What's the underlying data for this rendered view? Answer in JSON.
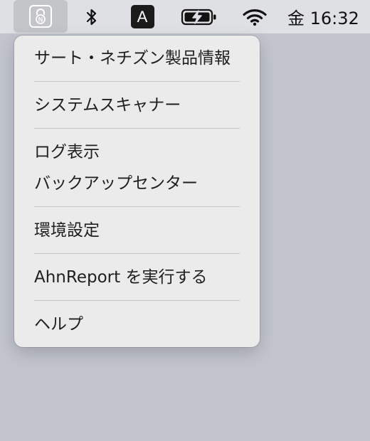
{
  "menubar": {
    "app_icon": "ahnlab-shield-lock-icon",
    "bluetooth_icon": "bluetooth-icon",
    "input_source": "A",
    "battery_icon": "battery-charging-icon",
    "wifi_icon": "wifi-icon",
    "clock": "金 16:32"
  },
  "menu": {
    "items": [
      "サート・ネチズン製品情報",
      "システムスキャナー",
      "ログ表示",
      "バックアップセンター",
      "環境設定",
      "AhnReport を実行する",
      "ヘルプ"
    ]
  }
}
